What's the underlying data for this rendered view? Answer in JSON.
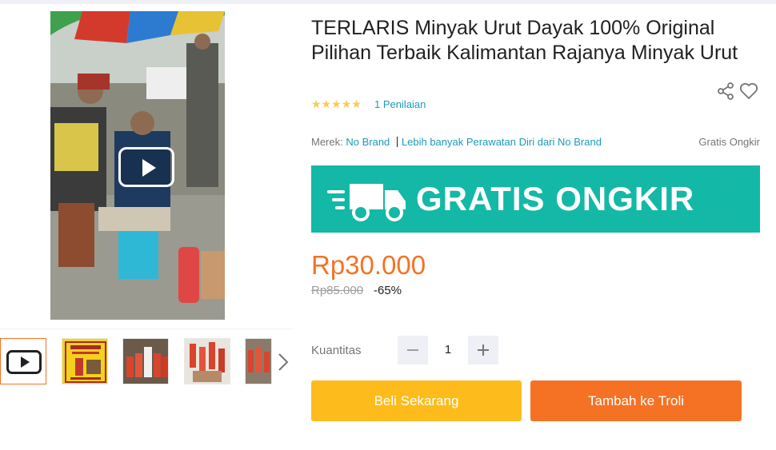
{
  "product": {
    "title": "TERLARIS Minyak Urut Dayak 100% Original Pilihan Terbaik Kalimantan Rajanya Minyak Urut",
    "rating_stars": 5,
    "rating_count_text": "1 Penilaian",
    "brand_label": "Merek:",
    "brand_name": "No Brand",
    "more_from_brand": "Lebih banyak Perawatan Diri dari No Brand",
    "free_shipping_note": "Gratis Ongkir",
    "banner_text": "GRATIS ONGKIR",
    "price": "Rp30.000",
    "original_price": "Rp85.000",
    "discount": "-65%"
  },
  "quantity": {
    "label": "Kuantitas",
    "value": "1"
  },
  "actions": {
    "buy_now": "Beli Sekarang",
    "add_to_cart": "Tambah ke Troli"
  },
  "gallery": {
    "thumbnails": [
      "video",
      "product-label",
      "bottles-row",
      "bottles-hand",
      "bottles-tray"
    ],
    "active_index": 0
  },
  "icons": [
    "play-icon",
    "chevron-right-icon",
    "share-icon",
    "heart-icon",
    "star-icon",
    "truck-icon",
    "minus-icon",
    "plus-icon"
  ],
  "colors": {
    "accent_orange": "#f57224",
    "buy_yellow": "#fdbc1b",
    "link_blue": "#1a9cb7",
    "banner_teal": "#14b8a6",
    "star_yellow": "#faca51"
  }
}
